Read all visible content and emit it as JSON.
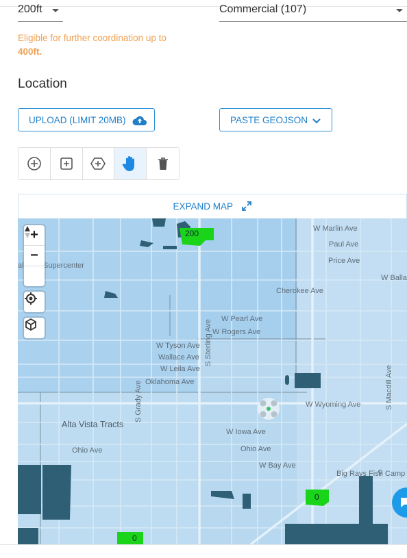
{
  "form": {
    "height_value": "200ft",
    "category_value": "Commercial (107)",
    "note_text": "Eligible for further coordination up to",
    "note_value": "400ft."
  },
  "location": {
    "title": "Location",
    "upload_label": "UPLOAD (LIMIT 20MB)",
    "paste_label": "PASTE GEOJSON"
  },
  "toolbar": {
    "tools": [
      "add-circle-icon",
      "add-square-icon",
      "add-polygon-icon",
      "hand-pan-icon",
      "trash-icon"
    ],
    "active_tool": "hand-pan-icon"
  },
  "map": {
    "expand_label": "EXPAND MAP",
    "zoom_in": "+",
    "zoom_out": "−",
    "grid_labels": [
      "200",
      "0",
      "0"
    ],
    "labels": {
      "marlin": "W Marlin Ave",
      "paul": "Paul Ave",
      "price": "Price Ave",
      "balla": "W Balla",
      "supercenter": "Supercenter",
      "al": "al",
      "cherokee": "Cherokee Ave",
      "pearl": "W Pearl Ave",
      "rogers": "W Rogers Ave",
      "tyson": "W Tyson Ave",
      "wallace": "Wallace Ave",
      "leila": "W Leila Ave",
      "oklahoma": "Oklahoma Ave",
      "sterling": "S Sterling Ave",
      "grady": "S Grady Ave",
      "macdill": "S Macdill Ave",
      "wyoming": "W Wyoming Ave",
      "altavista": "Alta Vista Tracts",
      "iowa": "W Iowa Ave",
      "ohio1": "Ohio Ave",
      "ohio2": "Ohio Ave",
      "bay": "W Bay Ave",
      "bigray": "Big Rays Fish Camp"
    },
    "colors": {
      "water": "#b7d8ef",
      "block": "#2f5f75",
      "grid_green": "#19d419",
      "accent": "#1f7fc8"
    }
  }
}
